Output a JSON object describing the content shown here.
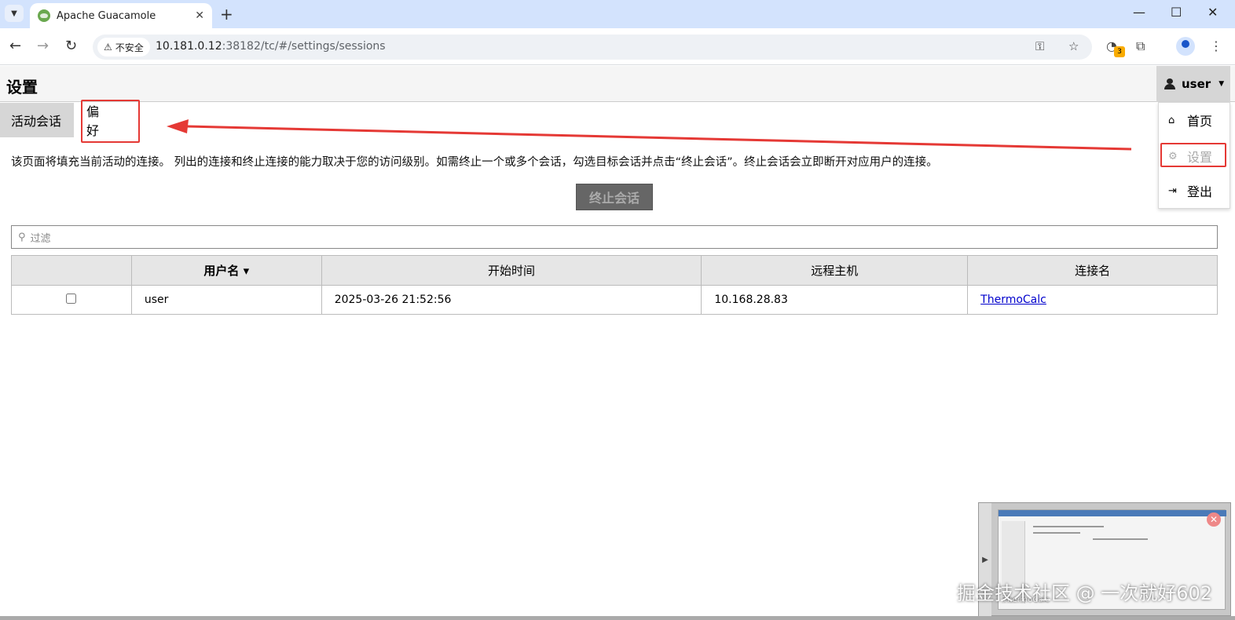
{
  "browser": {
    "tab_title": "Apache Guacamole",
    "tab_close": "✕",
    "new_tab": "+",
    "security_label": "不安全",
    "url_host": "10.181.0.12",
    "url_rest": ":38182/tc/#/settings/sessions",
    "extension_badge": "3"
  },
  "app": {
    "page_title": "设置",
    "user_name": "user",
    "menu": {
      "home": "首页",
      "settings": "设置",
      "logout": "登出"
    },
    "tabs": {
      "sessions": "活动会话",
      "preferences": "偏好"
    },
    "description": "该页面将填充当前活动的连接。 列出的连接和终止连接的能力取决于您的访问级别。如需终止一个或多个会话，勾选目标会话并点击“终止会话”。终止会话会立即断开对应用户的连接。",
    "kill_button": "终止会话",
    "filter_placeholder": "过滤",
    "table": {
      "headers": [
        "",
        "用户名",
        "开始时间",
        "远程主机",
        "连接名"
      ],
      "sort_indicator": "▾",
      "rows": [
        {
          "username": "user",
          "start_time": "2025-03-26 21:52:56",
          "remote_host": "10.168.28.83",
          "connection": "ThermoCalc"
        }
      ]
    }
  },
  "thumbnail": {
    "caption": "ThermoCalc"
  },
  "watermark": "掘金技术社区 @ 一次就好602",
  "colors": {
    "annotation_red": "#e53935",
    "link": "#0000cc",
    "tabbar": "#d3e3fd"
  }
}
